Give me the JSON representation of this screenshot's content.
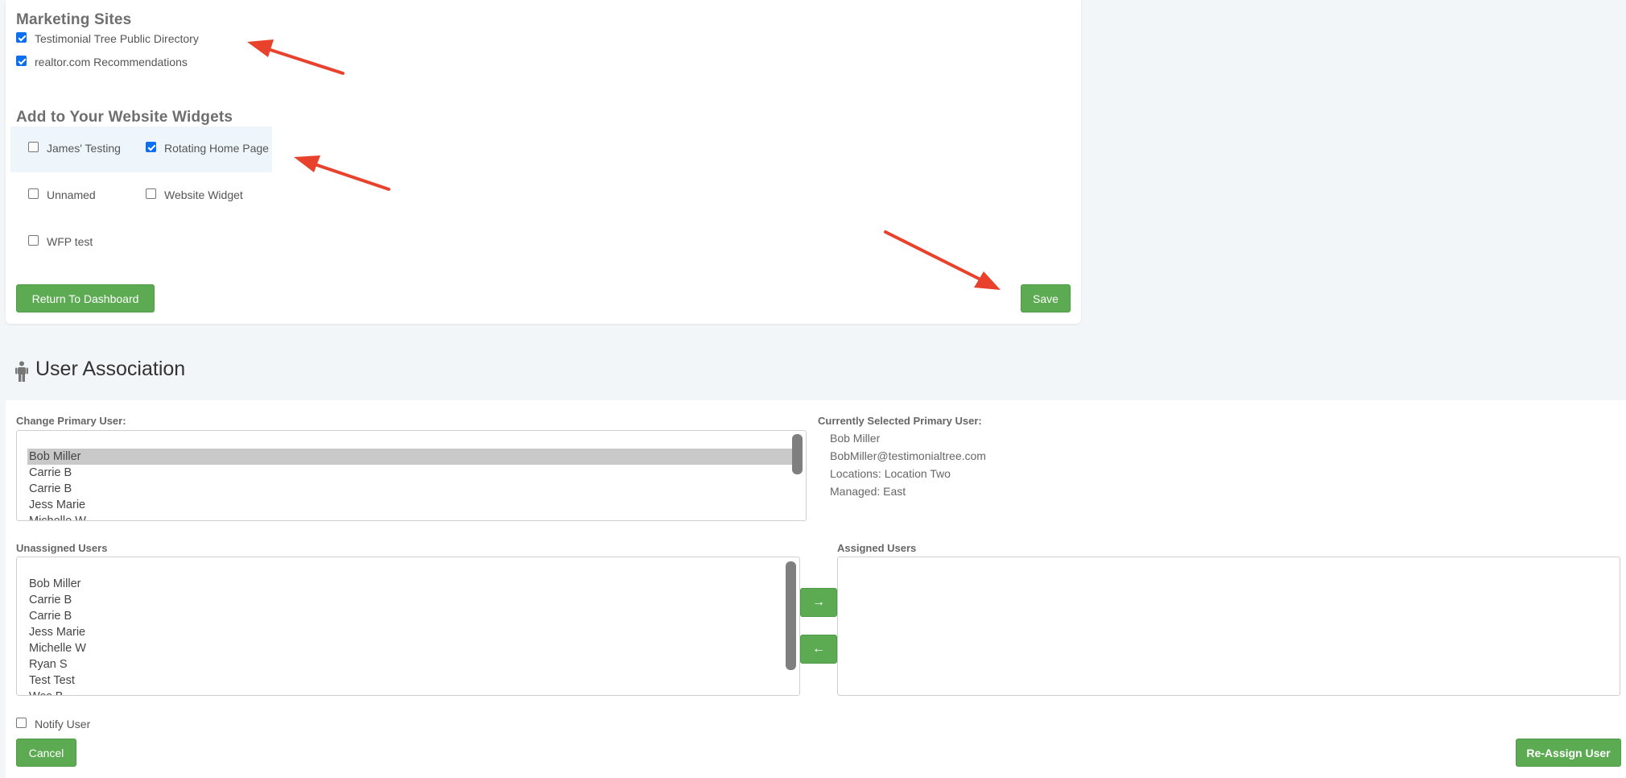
{
  "marketing_sites": {
    "heading": "Marketing Sites",
    "items": [
      {
        "label": "Testimonial Tree Public Directory",
        "checked": true
      },
      {
        "label": "realtor.com Recommendations",
        "checked": true
      }
    ]
  },
  "widgets": {
    "heading": "Add to Your Website Widgets",
    "items": [
      {
        "label": "James' Testing",
        "checked": false
      },
      {
        "label": "Rotating Home Page",
        "checked": true
      },
      {
        "label": "Unnamed",
        "checked": false
      },
      {
        "label": "Website Widget",
        "checked": false
      },
      {
        "label": "WFP test",
        "checked": false
      }
    ]
  },
  "actions": {
    "return_label": "Return To Dashboard",
    "save_label": "Save"
  },
  "user_association": {
    "title": "User Association",
    "change_primary_label": "Change Primary User:",
    "primary_options": [
      "Bob Miller",
      "Carrie B",
      "Carrie B",
      "Jess Marie",
      "Michelle W"
    ],
    "primary_selected": "Bob Miller",
    "current_label": "Currently Selected Primary User:",
    "current": {
      "name": "Bob Miller",
      "email": "BobMiller@testimonialtree.com",
      "locations": "Locations: Location Two",
      "managed": "Managed: East"
    },
    "unassigned_label": "Unassigned Users",
    "unassigned_users": [
      "Bob Miller",
      "Carrie B",
      "Carrie B",
      "Jess Marie",
      "Michelle W",
      "Ryan S",
      "Test Test",
      "Wes B"
    ],
    "assigned_label": "Assigned Users",
    "assigned_users": [],
    "move_right_label": "→",
    "move_left_label": "←",
    "notify_label": "Notify User",
    "notify_checked": false,
    "cancel_label": "Cancel",
    "reassign_label": "Re-Assign User"
  },
  "colors": {
    "accent_green": "#5cab52",
    "checkbox_blue": "#0b6ff0",
    "annotation_red": "#e8412c"
  }
}
